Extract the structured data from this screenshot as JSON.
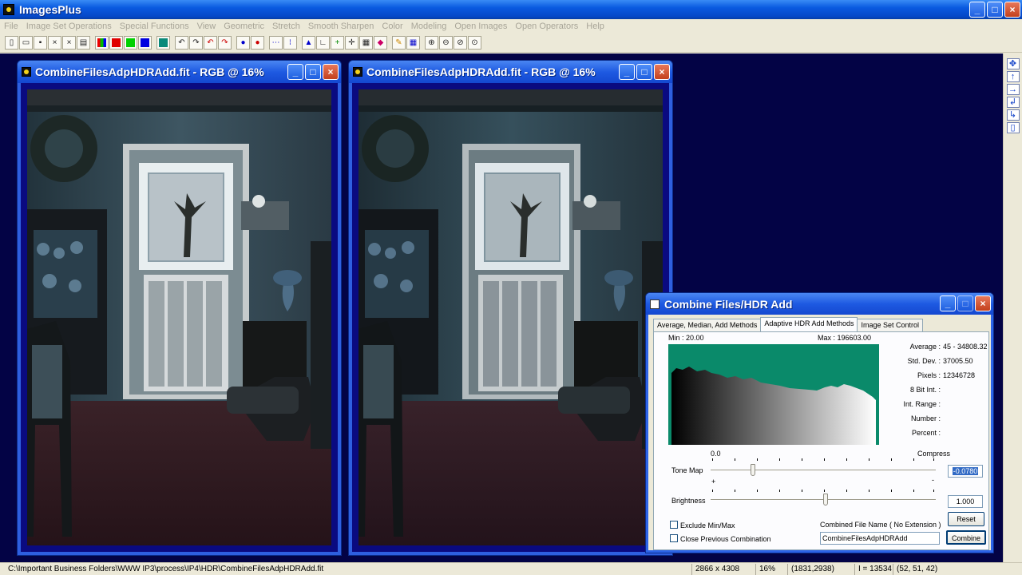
{
  "app": {
    "title": "ImagesPlus"
  },
  "menu": [
    "File",
    "Image Set Operations",
    "Special Functions",
    "View",
    "Geometric",
    "Stretch",
    "Smooth Sharpen",
    "Color",
    "Modeling",
    "Open Images",
    "Open Operators",
    "Help"
  ],
  "image_windows": [
    {
      "title": "CombineFilesAdpHDRAdd.fit - RGB @ 16%"
    },
    {
      "title": "CombineFilesAdpHDRAdd.fit - RGB @ 16%"
    }
  ],
  "dialog": {
    "title": "Combine Files/HDR Add",
    "tabs": [
      "Average, Median, Add Methods",
      "Adaptive HDR Add Methods",
      "Image Set Control"
    ],
    "active_tab": 1,
    "histogram": {
      "min_label": "Min : 20.00",
      "max_label": "Max : 196603.00"
    },
    "stats": {
      "average_label": "Average :",
      "average_value": "45 - 34808.32",
      "stddev_label": "Std. Dev. :",
      "stddev_value": "37005.50",
      "pixels_label": "Pixels :",
      "pixels_value": "12346728",
      "bit8_label": "8 Bit Int. :",
      "intrange_label": "Int. Range :",
      "number_label": "Number :",
      "percent_label": "Percent :"
    },
    "tone_map": {
      "label": "Tone Map",
      "left_label": "0.0",
      "right_label": "Compress",
      "plus_label": "+",
      "minus_label": "-",
      "value": "-0.0780",
      "position": 0.18
    },
    "brightness": {
      "label": "Brightness",
      "value": "1.000",
      "position": 0.51
    },
    "exclude_minmax": {
      "label": "Exclude Min/Max",
      "checked": false
    },
    "close_previous": {
      "label": "Close Previous Combination",
      "checked": false
    },
    "file_name": {
      "label": "Combined File Name (  No Extension  )",
      "value": "CombineFilesAdpHDRAdd"
    },
    "reset_label": "Reset",
    "combine_label": "Combine"
  },
  "status_bar": {
    "path": "C:\\Important Business Folders\\WWW IP3\\process\\IP4\\HDR\\CombineFilesAdpHDRAdd.fit",
    "dimensions": "2866 x 4308",
    "zoom": "16%",
    "coords": "(1831,2938)",
    "intensity": "I = 13534",
    "rgb": "(52, 51, 42)"
  }
}
